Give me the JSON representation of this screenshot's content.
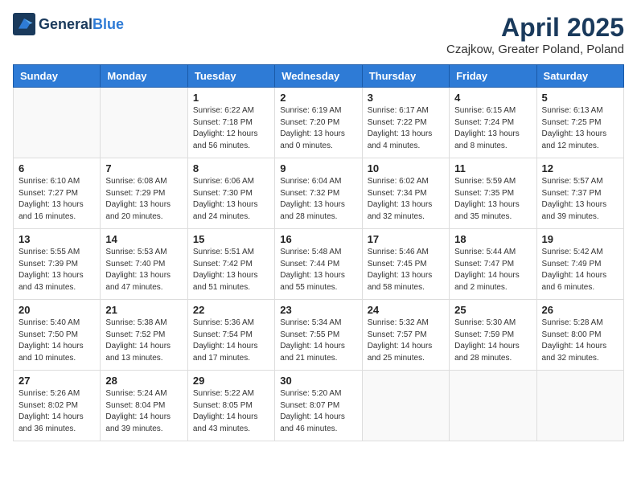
{
  "header": {
    "logo_general": "General",
    "logo_blue": "Blue",
    "month": "April 2025",
    "location": "Czajkow, Greater Poland, Poland"
  },
  "weekdays": [
    "Sunday",
    "Monday",
    "Tuesday",
    "Wednesday",
    "Thursday",
    "Friday",
    "Saturday"
  ],
  "weeks": [
    [
      {
        "day": "",
        "info": ""
      },
      {
        "day": "",
        "info": ""
      },
      {
        "day": "1",
        "info": "Sunrise: 6:22 AM\nSunset: 7:18 PM\nDaylight: 12 hours\nand 56 minutes."
      },
      {
        "day": "2",
        "info": "Sunrise: 6:19 AM\nSunset: 7:20 PM\nDaylight: 13 hours\nand 0 minutes."
      },
      {
        "day": "3",
        "info": "Sunrise: 6:17 AM\nSunset: 7:22 PM\nDaylight: 13 hours\nand 4 minutes."
      },
      {
        "day": "4",
        "info": "Sunrise: 6:15 AM\nSunset: 7:24 PM\nDaylight: 13 hours\nand 8 minutes."
      },
      {
        "day": "5",
        "info": "Sunrise: 6:13 AM\nSunset: 7:25 PM\nDaylight: 13 hours\nand 12 minutes."
      }
    ],
    [
      {
        "day": "6",
        "info": "Sunrise: 6:10 AM\nSunset: 7:27 PM\nDaylight: 13 hours\nand 16 minutes."
      },
      {
        "day": "7",
        "info": "Sunrise: 6:08 AM\nSunset: 7:29 PM\nDaylight: 13 hours\nand 20 minutes."
      },
      {
        "day": "8",
        "info": "Sunrise: 6:06 AM\nSunset: 7:30 PM\nDaylight: 13 hours\nand 24 minutes."
      },
      {
        "day": "9",
        "info": "Sunrise: 6:04 AM\nSunset: 7:32 PM\nDaylight: 13 hours\nand 28 minutes."
      },
      {
        "day": "10",
        "info": "Sunrise: 6:02 AM\nSunset: 7:34 PM\nDaylight: 13 hours\nand 32 minutes."
      },
      {
        "day": "11",
        "info": "Sunrise: 5:59 AM\nSunset: 7:35 PM\nDaylight: 13 hours\nand 35 minutes."
      },
      {
        "day": "12",
        "info": "Sunrise: 5:57 AM\nSunset: 7:37 PM\nDaylight: 13 hours\nand 39 minutes."
      }
    ],
    [
      {
        "day": "13",
        "info": "Sunrise: 5:55 AM\nSunset: 7:39 PM\nDaylight: 13 hours\nand 43 minutes."
      },
      {
        "day": "14",
        "info": "Sunrise: 5:53 AM\nSunset: 7:40 PM\nDaylight: 13 hours\nand 47 minutes."
      },
      {
        "day": "15",
        "info": "Sunrise: 5:51 AM\nSunset: 7:42 PM\nDaylight: 13 hours\nand 51 minutes."
      },
      {
        "day": "16",
        "info": "Sunrise: 5:48 AM\nSunset: 7:44 PM\nDaylight: 13 hours\nand 55 minutes."
      },
      {
        "day": "17",
        "info": "Sunrise: 5:46 AM\nSunset: 7:45 PM\nDaylight: 13 hours\nand 58 minutes."
      },
      {
        "day": "18",
        "info": "Sunrise: 5:44 AM\nSunset: 7:47 PM\nDaylight: 14 hours\nand 2 minutes."
      },
      {
        "day": "19",
        "info": "Sunrise: 5:42 AM\nSunset: 7:49 PM\nDaylight: 14 hours\nand 6 minutes."
      }
    ],
    [
      {
        "day": "20",
        "info": "Sunrise: 5:40 AM\nSunset: 7:50 PM\nDaylight: 14 hours\nand 10 minutes."
      },
      {
        "day": "21",
        "info": "Sunrise: 5:38 AM\nSunset: 7:52 PM\nDaylight: 14 hours\nand 13 minutes."
      },
      {
        "day": "22",
        "info": "Sunrise: 5:36 AM\nSunset: 7:54 PM\nDaylight: 14 hours\nand 17 minutes."
      },
      {
        "day": "23",
        "info": "Sunrise: 5:34 AM\nSunset: 7:55 PM\nDaylight: 14 hours\nand 21 minutes."
      },
      {
        "day": "24",
        "info": "Sunrise: 5:32 AM\nSunset: 7:57 PM\nDaylight: 14 hours\nand 25 minutes."
      },
      {
        "day": "25",
        "info": "Sunrise: 5:30 AM\nSunset: 7:59 PM\nDaylight: 14 hours\nand 28 minutes."
      },
      {
        "day": "26",
        "info": "Sunrise: 5:28 AM\nSunset: 8:00 PM\nDaylight: 14 hours\nand 32 minutes."
      }
    ],
    [
      {
        "day": "27",
        "info": "Sunrise: 5:26 AM\nSunset: 8:02 PM\nDaylight: 14 hours\nand 36 minutes."
      },
      {
        "day": "28",
        "info": "Sunrise: 5:24 AM\nSunset: 8:04 PM\nDaylight: 14 hours\nand 39 minutes."
      },
      {
        "day": "29",
        "info": "Sunrise: 5:22 AM\nSunset: 8:05 PM\nDaylight: 14 hours\nand 43 minutes."
      },
      {
        "day": "30",
        "info": "Sunrise: 5:20 AM\nSunset: 8:07 PM\nDaylight: 14 hours\nand 46 minutes."
      },
      {
        "day": "",
        "info": ""
      },
      {
        "day": "",
        "info": ""
      },
      {
        "day": "",
        "info": ""
      }
    ]
  ]
}
